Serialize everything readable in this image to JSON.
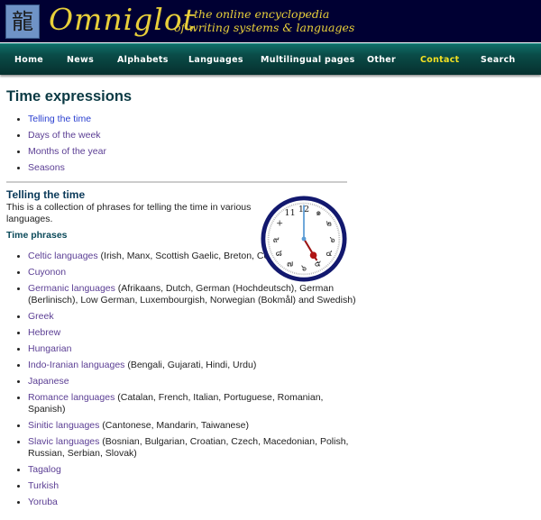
{
  "header": {
    "logo_glyph": "龍",
    "site_name": "Omniglot",
    "tagline_line1": "the online encyclopedia",
    "tagline_line2": "of writing systems & languages"
  },
  "nav": {
    "items": [
      {
        "label": "Home",
        "active": false
      },
      {
        "label": "News",
        "active": false
      },
      {
        "label": "Alphabets",
        "active": false
      },
      {
        "label": "Languages",
        "active": false
      },
      {
        "label": "Multilingual pages",
        "active": false
      },
      {
        "label": "Other",
        "active": false
      },
      {
        "label": "Contact",
        "active": true
      },
      {
        "label": "Search",
        "active": false
      }
    ]
  },
  "page": {
    "title": "Time expressions",
    "toc": [
      {
        "label": "Telling the time"
      },
      {
        "label": "Days of the week"
      },
      {
        "label": "Months of the year"
      },
      {
        "label": "Seasons"
      }
    ],
    "section_title": "Telling the time",
    "intro": "This is a collection of phrases for telling the time in various languages.",
    "subsection_title": "Time phrases",
    "clock": {
      "time_shown": "5:00",
      "icon": "clock-image"
    },
    "phrases": [
      {
        "link": "Celtic languages",
        "detail": " (Irish, Manx, Scottish Gaelic, Breton, Cornish and Welsh)"
      },
      {
        "link": "Cuyonon",
        "detail": ""
      },
      {
        "link": "Germanic languages",
        "detail": " (Afrikaans, Dutch, German (Hochdeutsch), German (Berlinisch), Low German, Luxembourgish, Norwegian (Bokmål) and Swedish)"
      },
      {
        "link": "Greek",
        "detail": ""
      },
      {
        "link": "Hebrew",
        "detail": ""
      },
      {
        "link": "Hungarian",
        "detail": ""
      },
      {
        "link": "Indo-Iranian languages",
        "detail": " (Bengali, Gujarati, Hindi, Urdu)"
      },
      {
        "link": "Japanese",
        "detail": ""
      },
      {
        "link": "Romance languages",
        "detail": " (Catalan, French, Italian, Portuguese, Romanian, Spanish)"
      },
      {
        "link": "Sinitic languages",
        "detail": " (Cantonese, Mandarin, Taiwanese)"
      },
      {
        "link": "Slavic languages",
        "detail": " (Bosnian, Bulgarian, Croatian, Czech, Macedonian, Polish, Russian, Serbian, Slovak)"
      },
      {
        "link": "Tagalog",
        "detail": ""
      },
      {
        "link": "Turkish",
        "detail": ""
      },
      {
        "link": "Yoruba",
        "detail": ""
      }
    ]
  },
  "colors": {
    "banner": "#000033",
    "logo_text": "#e8cf3a",
    "nav_active": "#f2e022",
    "visited_link": "#5b3e94",
    "current_link": "#2a3fd0"
  }
}
